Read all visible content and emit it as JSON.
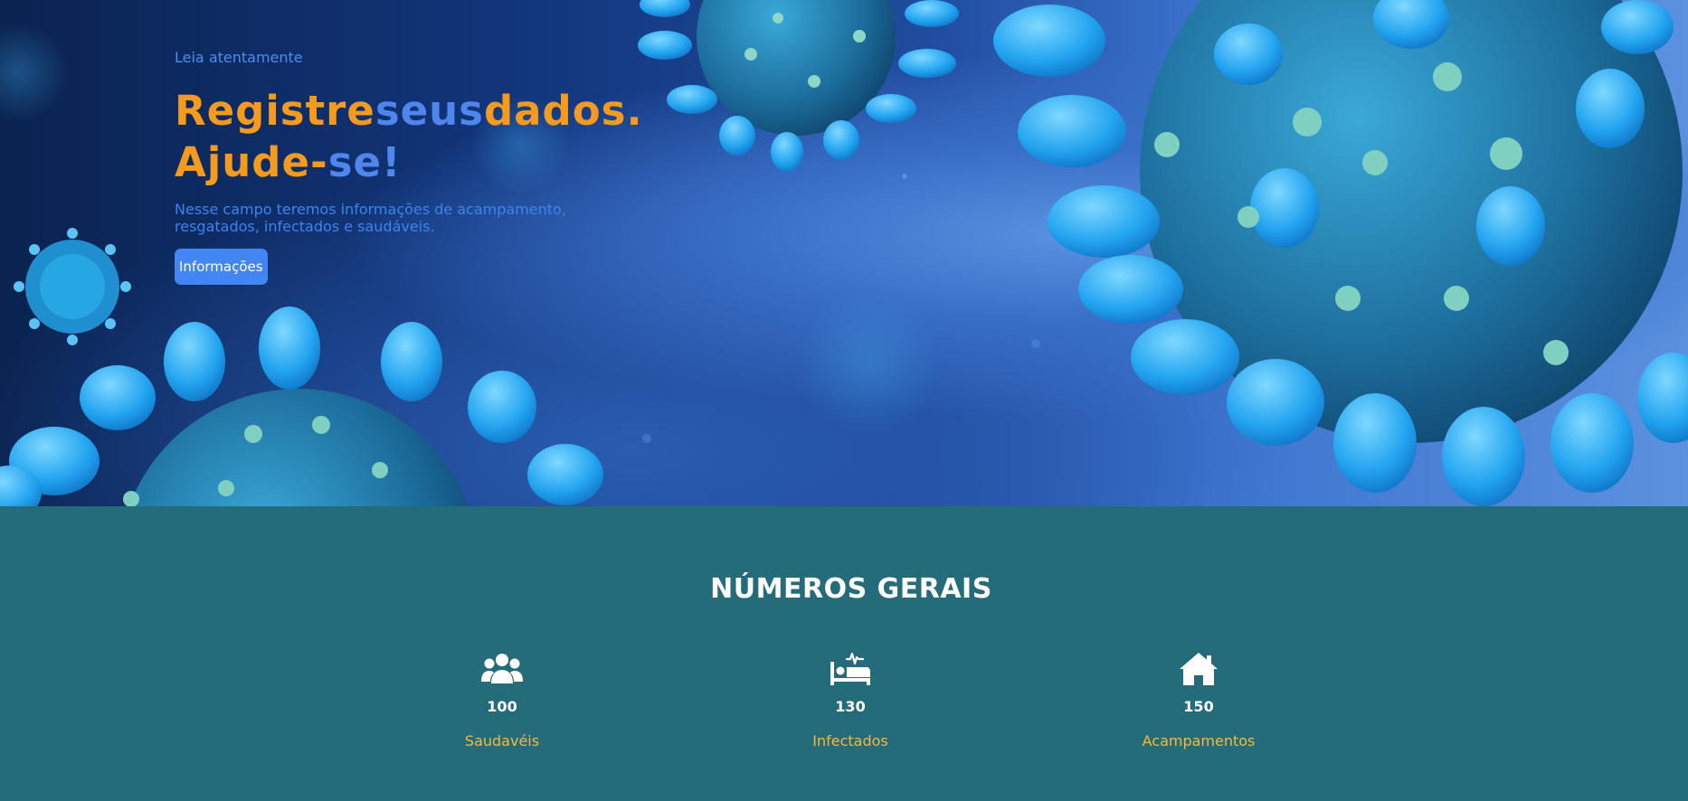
{
  "hero": {
    "eyebrow": "Leia atentamente",
    "headline": {
      "line1_part1": "Registre",
      "line1_part2": "seus",
      "line1_part3": "dados.",
      "line2_part1": "Ajude-",
      "line2_part2": "se!"
    },
    "description": "Nesse campo teremos informações de acampamento, resgatados, infectados e saudáveis.",
    "button_label": "Informações"
  },
  "stats": {
    "title": "NÚMEROS GERAIS",
    "items": [
      {
        "icon": "users-icon",
        "value": "100",
        "label": "Saudavéis"
      },
      {
        "icon": "hospital-bed-icon",
        "value": "130",
        "label": "Infectados"
      },
      {
        "icon": "home-icon",
        "value": "150",
        "label": "Acampamentos"
      }
    ]
  },
  "colors": {
    "accent_orange": "#f39a1f",
    "accent_blue": "#4f86ee",
    "button_blue": "#4186f2",
    "stats_background": "#256c7b",
    "stat_label": "#f5b93a"
  }
}
